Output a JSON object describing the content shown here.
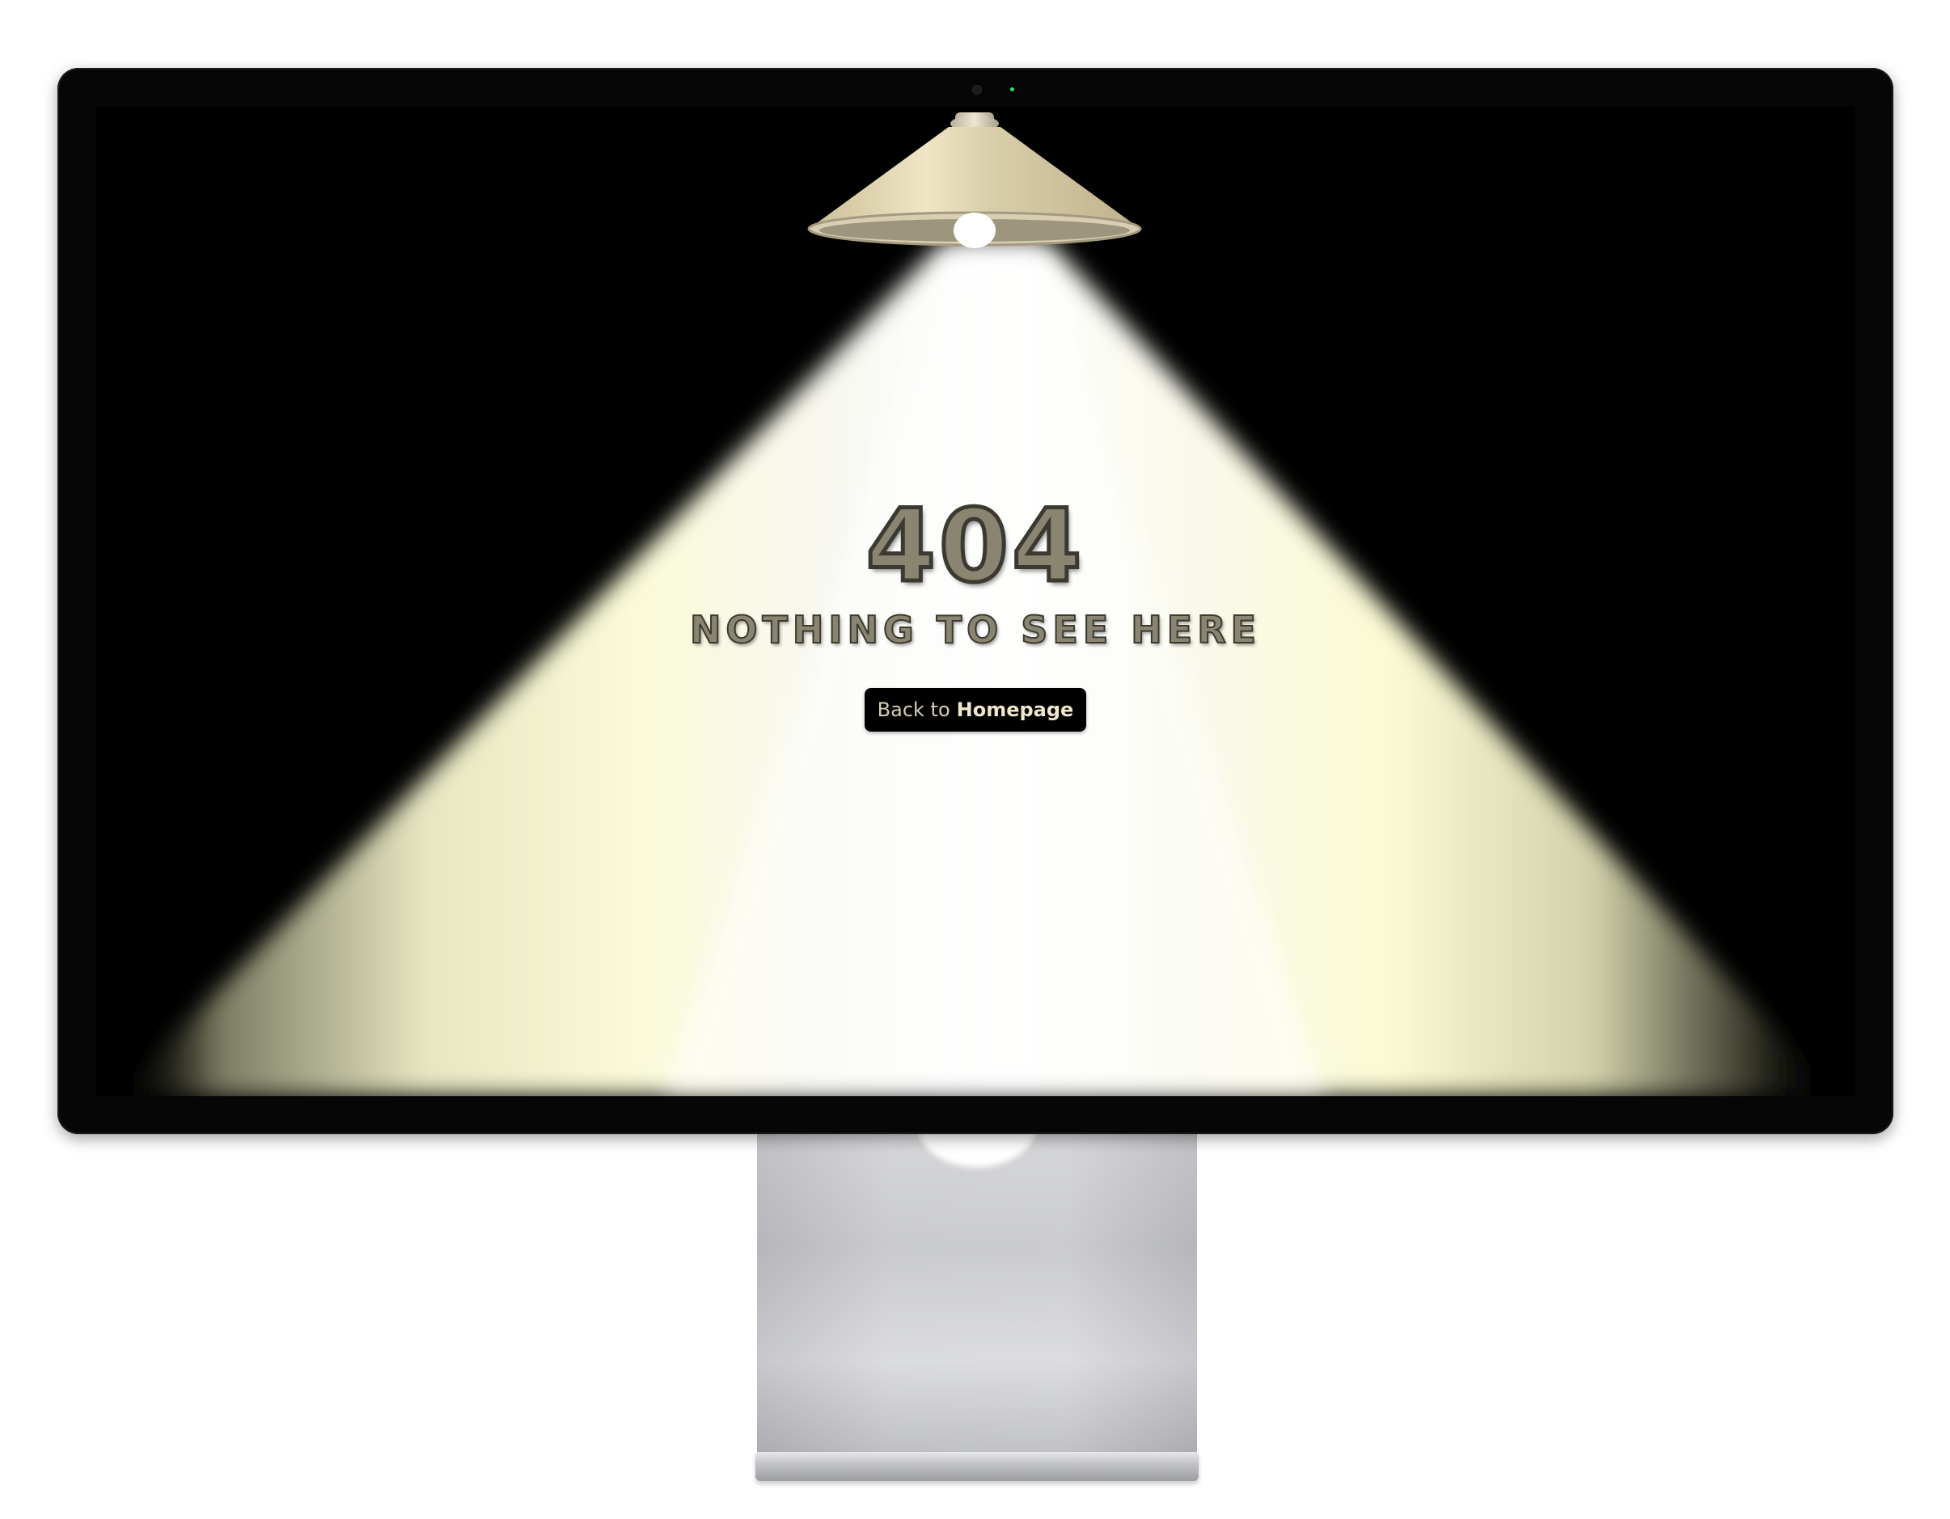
{
  "screen": {
    "error_code": "404",
    "error_message": "NOTHING TO SEE HERE",
    "button": {
      "prefix": "Back to",
      "label": "Homepage"
    }
  },
  "colors": {
    "background": "#000000",
    "beam_center": "#ffffff",
    "beam_edge": "#f7f7d2",
    "lamp_shade": "#d8ceaa",
    "text_fill": "#8a8571",
    "text_outline": "#3c3a30",
    "button_background": "#000000"
  },
  "icons": {
    "lamp": "ceiling-lamp-icon",
    "camera": "camera-icon"
  }
}
